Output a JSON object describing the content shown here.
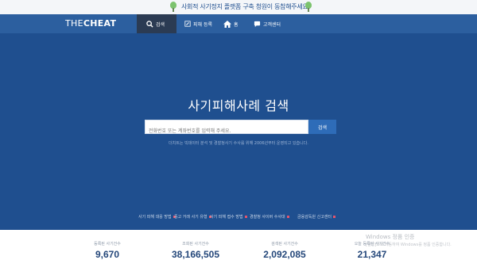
{
  "banner": {
    "message": "사회적 사기정지 플랫폼 구축 청원이 동참해주세요!"
  },
  "header": {
    "logo_thin": "THE",
    "logo_bold": "CHEAT",
    "nav": [
      {
        "label": "검색",
        "icon": "search-icon"
      },
      {
        "label": "피해 등록",
        "icon": "edit-icon"
      },
      {
        "label": "홈",
        "icon": "home-icon"
      },
      {
        "label": "고객센터",
        "icon": "chat-icon"
      }
    ]
  },
  "main": {
    "title": "사기피해사례 검색",
    "search_placeholder": "전화번호 또는 계좌번호를 입력해 주세요.",
    "search_button": "검색",
    "notice": "더치트는 빅데이터 분석 및 경찰청사기 수사를 위해 2006년부터 운영되고 있습니다.",
    "links": [
      "사기 피해 대응 방법",
      "중고 거래 사기 유형",
      "사기 피해 접수 방법",
      "경찰청 사이버 수사대",
      "금융감독원 신고센터"
    ]
  },
  "stats": [
    {
      "label": "등록된 사기건수",
      "value": "9,670"
    },
    {
      "label": "조회된 사기건수",
      "value": "38,166,505"
    },
    {
      "label": "검색된 사기건수",
      "value": "2,092,085"
    },
    {
      "label": "오늘 등록된 사기건수",
      "value": "21,347"
    }
  ],
  "watermark": {
    "title": "Windows 정품 인증",
    "subtitle": "[설정]으로 이동하여 Windows를 정품 인증합니다."
  },
  "colors": {
    "header": "#2c5f9f",
    "main": "#1f4f8f",
    "accent": "#2e6cb8",
    "link_dot": "#e2546c"
  }
}
